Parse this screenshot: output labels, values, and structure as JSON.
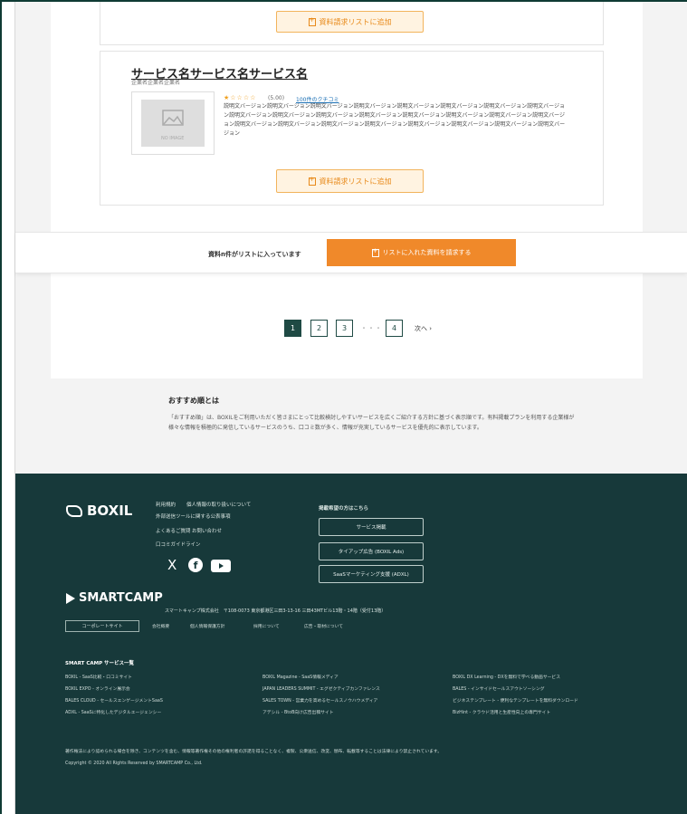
{
  "cards": {
    "add_button_label": "資料請求リストに追加",
    "service_title": "サービス名サービス名サービス名",
    "company": "企業名企業名企業名",
    "stars": "★☆☆☆☆",
    "rating": "(5.00)",
    "reviews": "100件のクチコミ",
    "thumbnail_label": "NO IMAGE",
    "description": "説明文バージョン説明文バージョン説明文バージョン説明文バージョン説明文バージョン説明文バージョン説明文バージョン説明文バージョン説明文バージョン説明文バージョン説明文バージョン説明文バージョン説明文バージョン説明文バージョン説明文バージョン説明文バージョン説明文バージョン説明文バージョン説明文バージョン説明文バージョン説明文バージョン説明文バージョン説明文バージョン説明文バージョン"
  },
  "sticky": {
    "status": "資料n件がリストに入っています",
    "request_button": "リストに入れた資料を請求する"
  },
  "pagination": {
    "pages": [
      "1",
      "2",
      "3",
      "4"
    ],
    "ellipsis": "・・・",
    "next": "次へ ›"
  },
  "recommend": {
    "title": "おすすめ順とは",
    "text": "「おすすめ順」は、BOXILをご利用いただく皆さまにとって比較検討しやすいサービスを広くご紹介する方針に基づく表示順です。有料掲載プランを利用する企業様が様々な情報を積極的に発信しているサービスのうち、口コミ数が多く、情報が充実しているサービスを優先的に表示しています。"
  },
  "footer": {
    "brand": "BOXIL",
    "links_col1": [
      "利用規約",
      "個人情報の取り扱いについて",
      "外部送信ツールに関する公表事項",
      "よくあるご質問",
      "お問い合わせ",
      "口コミガイドライン"
    ],
    "contact_heading": "掲載希望の方はこちら",
    "contact_buttons": [
      "サービス掲載",
      "タイアップ広告 (BOXIL Ads)",
      "SaaSマーケティング支援 (ADXL)"
    ],
    "social": [
      "X",
      "facebook",
      "youtube"
    ],
    "company_brand": "SMARTCAMP",
    "company_address": "スマートキャンプ株式会社　〒108-0073 東京都港区三田3-13-16 三田43MTビル13階・14階（受付13階）",
    "corporate_site": "コーポレートサイト",
    "company_links": [
      "会社概要",
      "個人情報保護方針",
      "採用について",
      "広告・取材について"
    ],
    "services_heading": "SMART CAMP サービス一覧",
    "services": [
      "BOXIL - SaaS比較・口コミサイト",
      "BOXIL Magazine - SaaS情報メディア",
      "BOXIL DX Learning - DXを無料で学べる動画サービス",
      "BOXIL EXPO - オンライン展示会",
      "JAPAN LEADERS SUMMIT - エグゼクティブカンファレンス",
      "BALES - インサイドセールスアウトソーシング",
      "BALES CLOUD - セールスエンゲージメントSaaS",
      "SALES TOWN - 営業力を高めるセールスノウハウメディア",
      "ビジネステンプレート - 便利なテンプレートを無料ダウンロード",
      "ADXL - SaaSに特化したデジタルエージェンシー",
      "アデシル - BtoB向け広告出稿サイト",
      "BizHint - クラウド活用と生産性向上の専門サイト"
    ],
    "legal": "著作権法により認められる場合を除き、コンテンツを含む、情報等著作権その他の権利者の許諾を得ることなく、複製、公衆送信、改変、頒布、転載等することは法律により禁止されています。",
    "copyright": "Copyright © 2020 All Rights Reserved by SMARTCAMP Co., Ltd."
  }
}
